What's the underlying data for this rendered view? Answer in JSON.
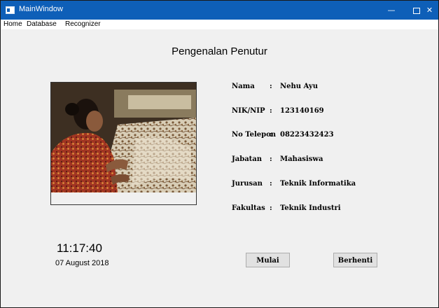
{
  "window": {
    "title": "MainWindow",
    "controls": {
      "minimize": "—",
      "maximize": "",
      "close": "✕"
    }
  },
  "menu": [
    "Home",
    "Database",
    "Recognizer"
  ],
  "page_title": "Pengenalan Penutur",
  "photo": {
    "icon": "person-photo"
  },
  "info": {
    "colon": ":",
    "rows": [
      {
        "label": "Nama",
        "value": "Nehu Ayu"
      },
      {
        "label": "NIK/NIP",
        "value": "123140169"
      },
      {
        "label": "No Telepon",
        "value": "08223432423"
      },
      {
        "label": "Jabatan",
        "value": "Mahasiswa"
      },
      {
        "label": "Jurusan",
        "value": "Teknik Informatika"
      },
      {
        "label": "Fakultas",
        "value": "Teknik Industri"
      }
    ]
  },
  "clock": {
    "time": "11:17:40",
    "date": "07 August 2018"
  },
  "buttons": {
    "start": "Mulai",
    "stop": "Berhenti"
  },
  "colors": {
    "titlebar": "#0e5fb8",
    "window_bg": "#f0f0f0",
    "button_bg": "#e1e1e1"
  }
}
